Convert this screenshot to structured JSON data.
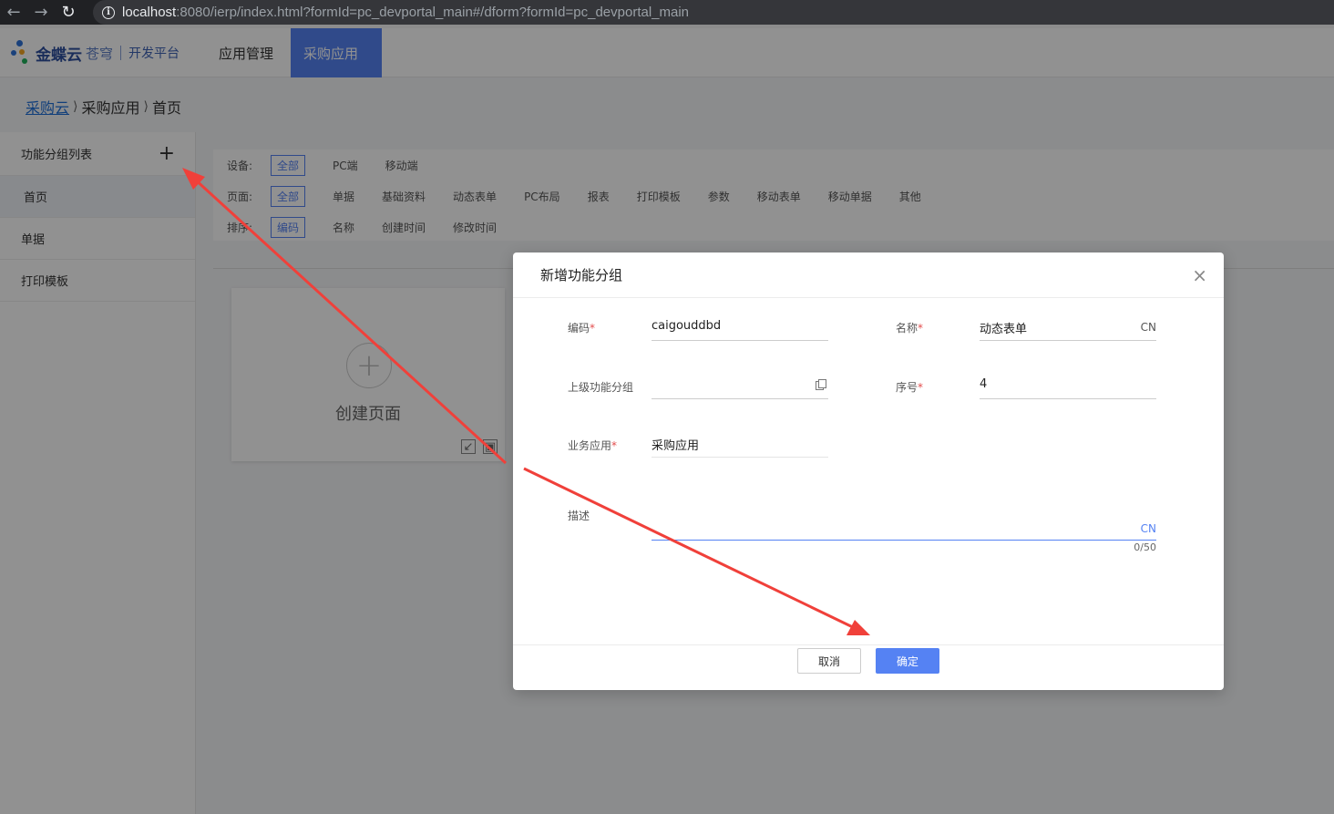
{
  "browser": {
    "url_host": "localhost",
    "url_rest": ":8080/ierp/index.html?formId=pc_devportal_main#/dform?formId=pc_devportal_main"
  },
  "topnav": {
    "logo_text": "金蝶云",
    "logo_sub": "苍穹",
    "logo_portal": "开发平台",
    "tabs": [
      {
        "label": "应用管理",
        "active": false
      },
      {
        "label": "采购应用",
        "active": true
      }
    ]
  },
  "breadcrumb": {
    "items": [
      "采购云",
      "采购应用",
      "首页"
    ]
  },
  "sidebar": {
    "title": "功能分组列表",
    "add_symbol": "+",
    "items": [
      {
        "label": "首页",
        "active": true
      },
      {
        "label": "单据",
        "active": false
      },
      {
        "label": "打印模板",
        "active": false
      }
    ]
  },
  "filters": {
    "device": {
      "label": "设备:",
      "options": [
        "全部",
        "PC端",
        "移动端"
      ],
      "selected": "全部"
    },
    "page": {
      "label": "页面:",
      "options": [
        "全部",
        "单据",
        "基础资料",
        "动态表单",
        "PC布局",
        "报表",
        "打印模板",
        "参数",
        "移动表单",
        "移动单据",
        "其他"
      ],
      "selected": "全部"
    },
    "sort": {
      "label": "排序:",
      "options": [
        "编码",
        "名称",
        "创建时间",
        "修改时间"
      ],
      "selected": "编码"
    }
  },
  "create_card": {
    "label": "创建页面",
    "plus": "+"
  },
  "modal": {
    "title": "新增功能分组",
    "close_symbol": "×",
    "fields": {
      "code": {
        "label": "编码",
        "required": true,
        "value": "caigouddbd"
      },
      "name": {
        "label": "名称",
        "required": true,
        "value": "动态表单",
        "suffix": "CN"
      },
      "parent": {
        "label": "上级功能分组",
        "required": false,
        "value": ""
      },
      "seq": {
        "label": "序号",
        "required": true,
        "value": "4"
      },
      "biz_app": {
        "label": "业务应用",
        "required": true,
        "value": "采购应用"
      },
      "desc": {
        "label": "描述",
        "required": false,
        "value": "",
        "suffix": "CN",
        "counter": "0/50"
      }
    },
    "cancel_label": "取消",
    "ok_label": "确定"
  },
  "colors": {
    "accent": "#5582f3",
    "annotation_arrow": "#f0403a",
    "required": "#e34d4d"
  }
}
